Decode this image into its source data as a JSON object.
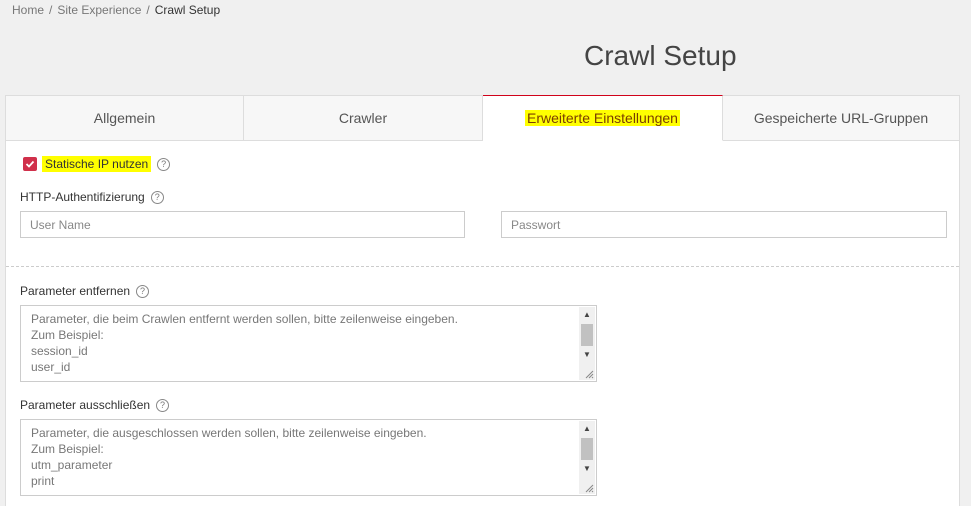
{
  "breadcrumb": {
    "home": "Home",
    "section": "Site Experience",
    "current": "Crawl Setup",
    "separator": "/"
  },
  "page": {
    "title": "Crawl Setup"
  },
  "tabs": [
    {
      "label": "Allgemein"
    },
    {
      "label": "Crawler"
    },
    {
      "label": "Erweiterte Einstellungen",
      "active": true
    },
    {
      "label": "Gespeicherte URL-Gruppen"
    }
  ],
  "static_ip": {
    "label": "Statische IP nutzen",
    "checked": true
  },
  "http_auth": {
    "label": "HTTP-Authentifizierung",
    "username_placeholder": "User Name",
    "password_placeholder": "Passwort"
  },
  "remove_params": {
    "label": "Parameter entfernen",
    "placeholder_lines": [
      "Parameter, die beim Crawlen entfernt werden sollen, bitte zeilenweise eingeben.",
      "Zum Beispiel:",
      "session_id",
      "user_id"
    ]
  },
  "exclude_params": {
    "label": "Parameter ausschließen",
    "placeholder_lines": [
      "Parameter, die ausgeschlossen werden sollen, bitte zeilenweise eingeben.",
      "Zum Beispiel:",
      "utm_parameter",
      "print"
    ]
  },
  "help_symbol": "?",
  "colors": {
    "accent": "#d0021b",
    "checkbox": "#d0304b",
    "highlight": "#ffff00"
  }
}
